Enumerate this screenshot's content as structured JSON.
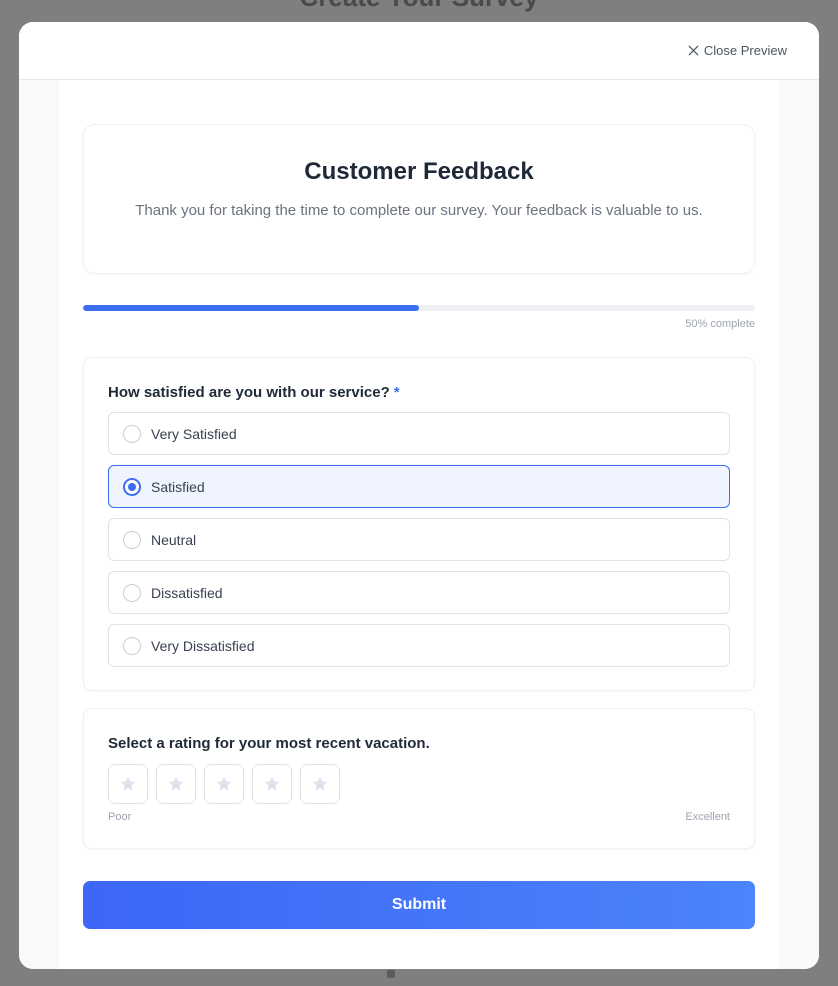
{
  "backdrop": {
    "title": "Create Your Survey"
  },
  "modal": {
    "close_label": "Close Preview"
  },
  "survey": {
    "title": "Customer Feedback",
    "description": "Thank you for taking the time to complete our survey. Your feedback is valuable to us."
  },
  "progress": {
    "percent": 50,
    "label": "50% complete"
  },
  "question1": {
    "label": "How satisfied are you with our service?",
    "required_mark": "*",
    "selected": "Satisfied",
    "options": [
      {
        "label": "Very Satisfied"
      },
      {
        "label": "Satisfied"
      },
      {
        "label": "Neutral"
      },
      {
        "label": "Dissatisfied"
      },
      {
        "label": "Very Dissatisfied"
      }
    ]
  },
  "question2": {
    "label": "Select a rating for your most recent vacation.",
    "max_stars": 5,
    "selected_stars": 0,
    "low_label": "Poor",
    "high_label": "Excellent"
  },
  "submit": {
    "label": "Submit"
  },
  "colors": {
    "accent": "#3b6ef0",
    "star_empty": "#dbe3ec",
    "backdrop": "#7f7f7f"
  }
}
